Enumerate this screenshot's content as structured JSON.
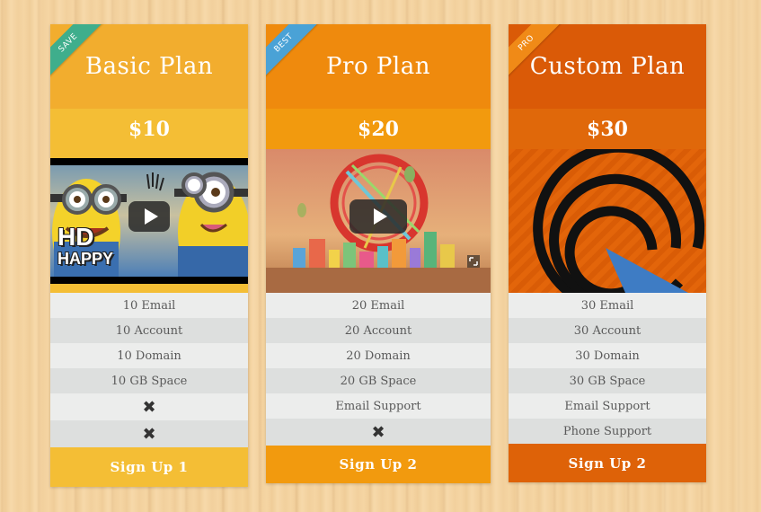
{
  "plans": [
    {
      "ribbon": "SAVE",
      "name": "Basic Plan",
      "price": "$10",
      "media_text": {
        "line1": "HD",
        "line2": "HAPPY"
      },
      "features": [
        "10 Email",
        "10 Account",
        "10 Domain",
        "10 GB Space"
      ],
      "excluded": [
        "✖",
        "✖"
      ],
      "signup": "Sign Up 1",
      "colors": {
        "head": "#f2ad2e",
        "price": "#f4be35",
        "ribbon": "#3fae8c",
        "signup": "#f4be35"
      }
    },
    {
      "ribbon": "BEST",
      "name": "Pro Plan",
      "price": "$20",
      "features": [
        "20 Email",
        "20 Account",
        "20 Domain",
        "20 GB Space",
        "Email Support"
      ],
      "excluded": [
        "✖"
      ],
      "signup": "Sign Up 2",
      "colors": {
        "head": "#ef8a0d",
        "price": "#f29a0e",
        "ribbon": "#4aa2d6",
        "signup": "#f29a0e"
      }
    },
    {
      "ribbon": "PRO",
      "name": "Custom Plan",
      "price": "$30",
      "features": [
        "30 Email",
        "30 Account",
        "30 Domain",
        "30 GB Space",
        "Email Support",
        "Phone Support"
      ],
      "excluded": [],
      "signup": "Sign Up 2",
      "colors": {
        "head": "#da5a07",
        "price": "#e0680a",
        "ribbon": "#f08a17",
        "signup": "#de6208"
      }
    }
  ]
}
